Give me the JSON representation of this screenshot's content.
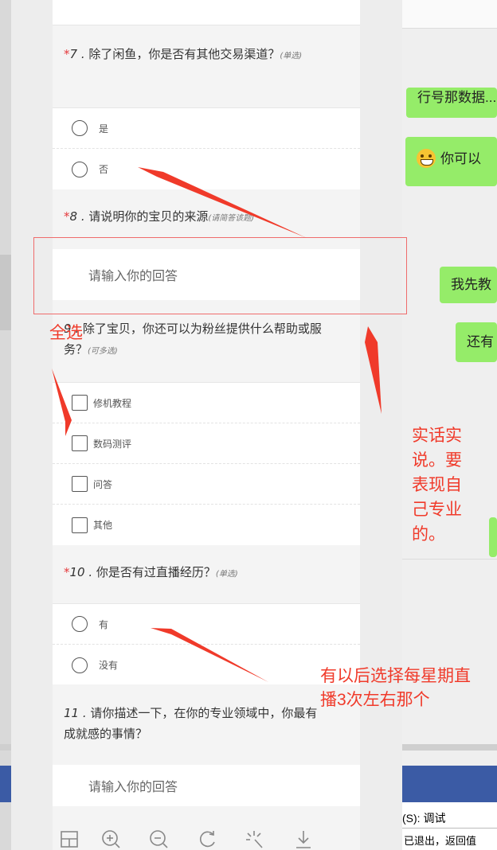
{
  "chat": {
    "bubble_1": "行号那数据...",
    "bubble_2": "你可以",
    "bubble_3": "我先教",
    "bubble_4": "还有"
  },
  "survey": {
    "q7": {
      "star": "*",
      "number": "7",
      "text": "除了闲鱼，你是否有其他交易渠道？",
      "hint": "(单选)",
      "options": [
        "是",
        "否"
      ]
    },
    "q8": {
      "star": "*",
      "number": "8",
      "text": "请说明你的宝贝的来源",
      "hint": "(请简答该题)",
      "placeholder": "请输入你的回答"
    },
    "q9": {
      "number": "9",
      "text": "除了宝贝，你还可以为粉丝提供什么帮助或服务？",
      "hint": "(可多选)",
      "options": [
        "修机教程",
        "数码测评",
        "问答",
        "其他"
      ]
    },
    "q10": {
      "star": "*",
      "number": "10",
      "text": "你是否有过直播经历？",
      "hint": "(单选)",
      "options": [
        "有",
        "没有"
      ]
    },
    "q11": {
      "number": "11",
      "text": "请你描述一下，在你的专业领域中，你最有成就感的事情？",
      "placeholder": "请输入你的回答"
    }
  },
  "annotations": {
    "select_all": "全选",
    "honest": "实话实说。要表现自己专业的。",
    "live": "有以后选择每星期直播3次左右那个",
    "color": "#f03a2a"
  },
  "bottom": {
    "debug_label": "(S): 调试",
    "status_line": "已退出，返回值"
  },
  "toolbar_icons": [
    "fit-page-icon",
    "zoom-in-icon",
    "zoom-out-icon",
    "rotate-icon",
    "magic-icon",
    "download-icon"
  ]
}
